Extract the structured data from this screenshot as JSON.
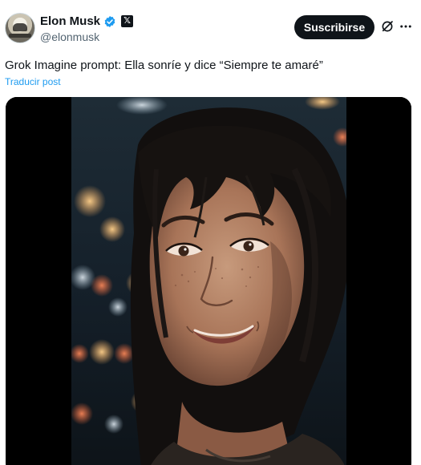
{
  "post": {
    "author": {
      "display_name": "Elon Musk",
      "handle": "@elonmusk",
      "verified_icon": "verified-badge-icon",
      "affiliation_icon": "x-logo-icon",
      "affiliation_text": "𝕏"
    },
    "subscribe_label": "Suscribirse",
    "text": "Grok Imagine prompt: Ella sonríe y dice “Siempre te amaré”",
    "translate_label": "Traducir post",
    "media": {
      "type": "video-frame",
      "description_icon": "portrait-photo"
    }
  },
  "colors": {
    "text": "#0f1419",
    "secondary_text": "#536471",
    "link": "#1d9bf0",
    "verified": "#1d9bf0",
    "button_bg": "#0f1419",
    "button_text": "#ffffff",
    "media_bg": "#000000"
  }
}
